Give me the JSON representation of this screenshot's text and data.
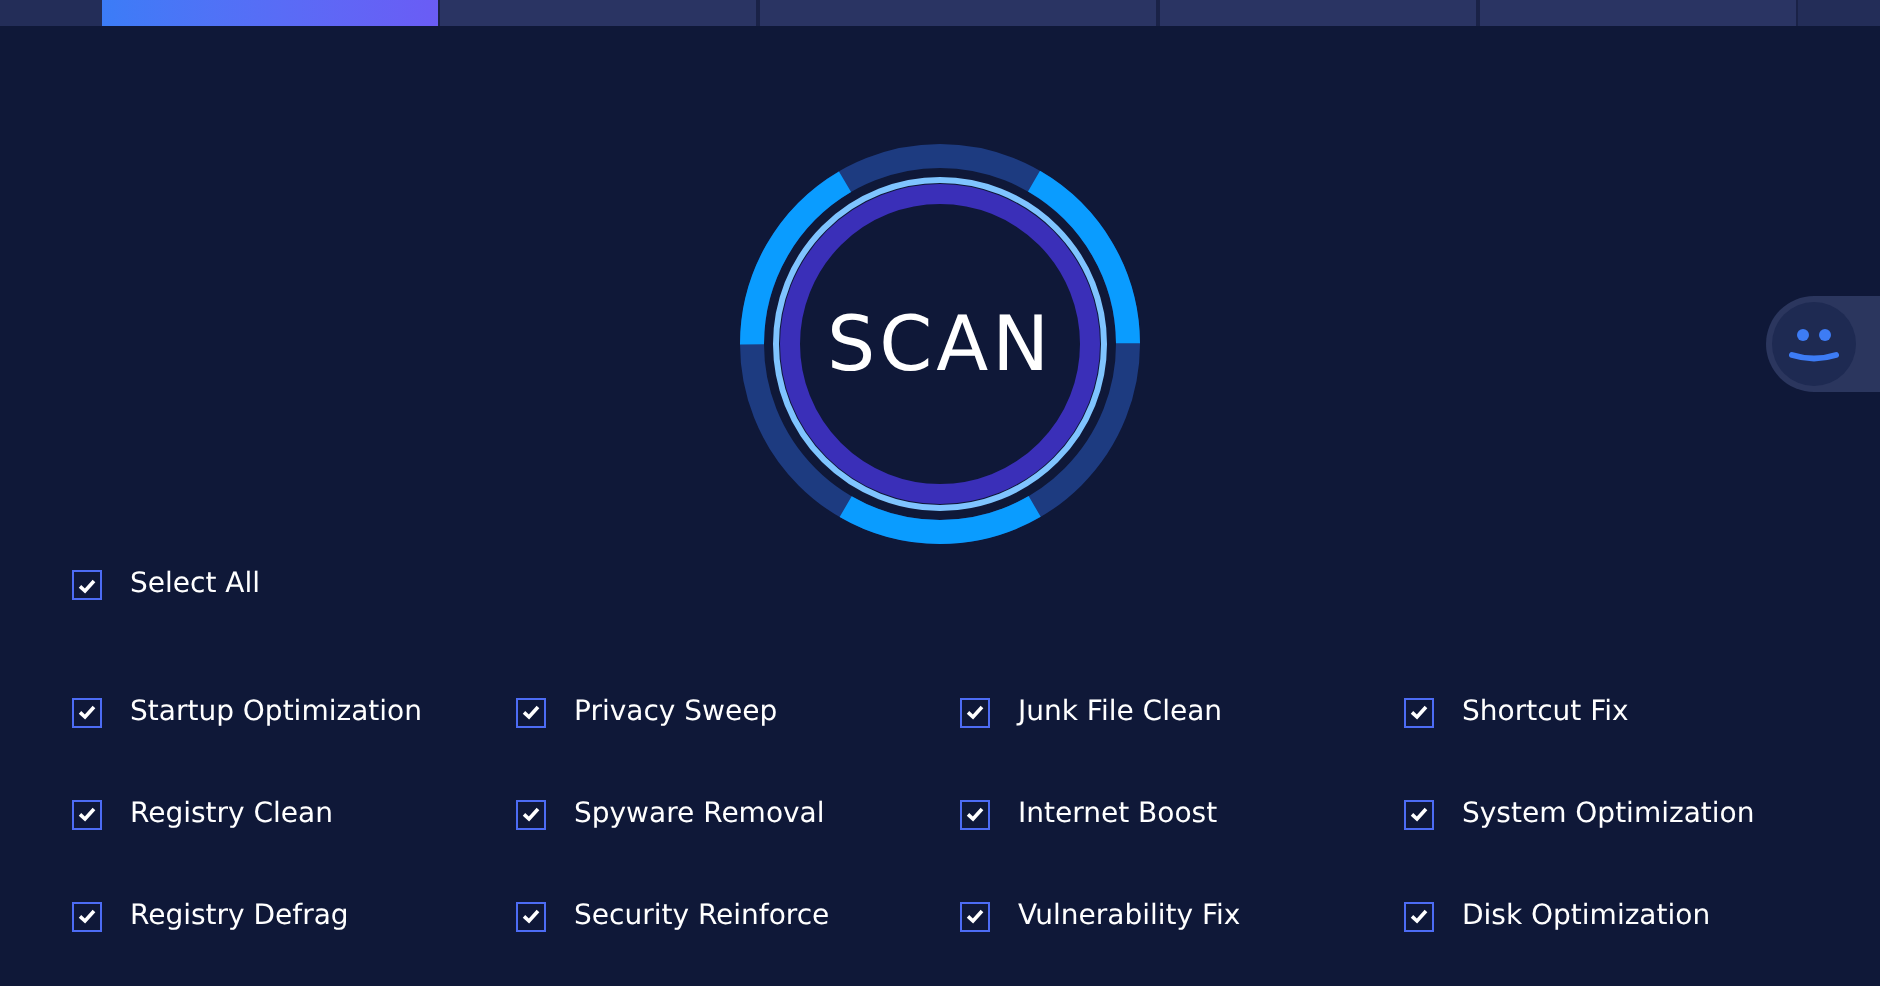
{
  "tabs": [
    {
      "selected": true
    },
    {
      "selected": false
    },
    {
      "selected": false
    },
    {
      "selected": false
    },
    {
      "selected": false
    }
  ],
  "scan_button": {
    "label": "SCAN"
  },
  "select_all": {
    "label": "Select All",
    "checked": true
  },
  "options": [
    {
      "label": "Startup Optimization",
      "checked": true
    },
    {
      "label": "Privacy Sweep",
      "checked": true
    },
    {
      "label": "Junk File Clean",
      "checked": true
    },
    {
      "label": "Shortcut Fix",
      "checked": true
    },
    {
      "label": "Registry Clean",
      "checked": true
    },
    {
      "label": "Spyware Removal",
      "checked": true
    },
    {
      "label": "Internet Boost",
      "checked": true
    },
    {
      "label": "System Optimization",
      "checked": true
    },
    {
      "label": "Registry Defrag",
      "checked": true
    },
    {
      "label": "Security Reinforce",
      "checked": true
    },
    {
      "label": "Vulnerability Fix",
      "checked": true
    },
    {
      "label": "Disk Optimization",
      "checked": true
    }
  ]
}
